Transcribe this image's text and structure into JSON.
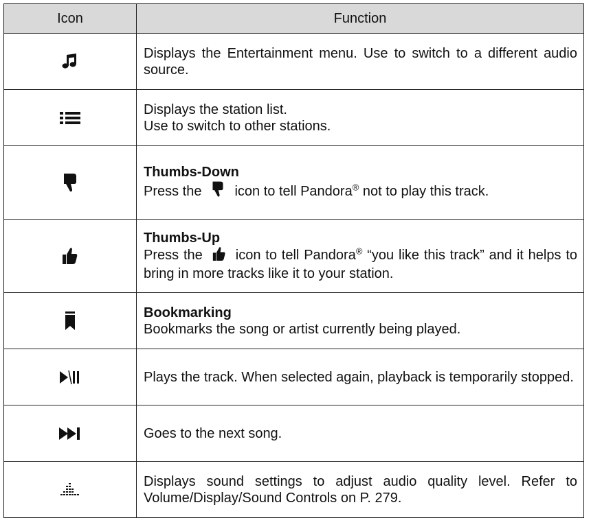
{
  "table": {
    "header": {
      "icon": "Icon",
      "function": "Function"
    },
    "rows": [
      {
        "icon": "music-note-icon",
        "title": "",
        "text": "Displays the Entertainment menu. Use to switch to a different audio source."
      },
      {
        "icon": "list-icon",
        "title": "",
        "line1": "Displays the station list.",
        "line2": "Use to switch to other stations."
      },
      {
        "icon": "thumbs-down-icon",
        "title": "Thumbs-Down",
        "pre": "Press the",
        "mid": "icon to tell Pandora",
        "reg": "®",
        "post": "not to play this track."
      },
      {
        "icon": "thumbs-up-icon",
        "title": "Thumbs-Up",
        "pre": "Press the",
        "mid": "icon to tell Pandora",
        "reg": "®",
        "post": "“you like this track” and it helps to bring in more tracks like it to your station."
      },
      {
        "icon": "bookmark-icon",
        "title": "Bookmarking",
        "text": "Bookmarks the song or artist currently being played."
      },
      {
        "icon": "play-pause-icon",
        "title": "",
        "text": "Plays the track. When selected again, playback is temporarily stopped."
      },
      {
        "icon": "next-track-icon",
        "title": "",
        "text": "Goes to the next song."
      },
      {
        "icon": "sound-settings-icon",
        "title": "",
        "text": "Displays sound settings to adjust audio quality level. Refer to Volume/Display/Sound Controls on P. 279."
      }
    ]
  }
}
